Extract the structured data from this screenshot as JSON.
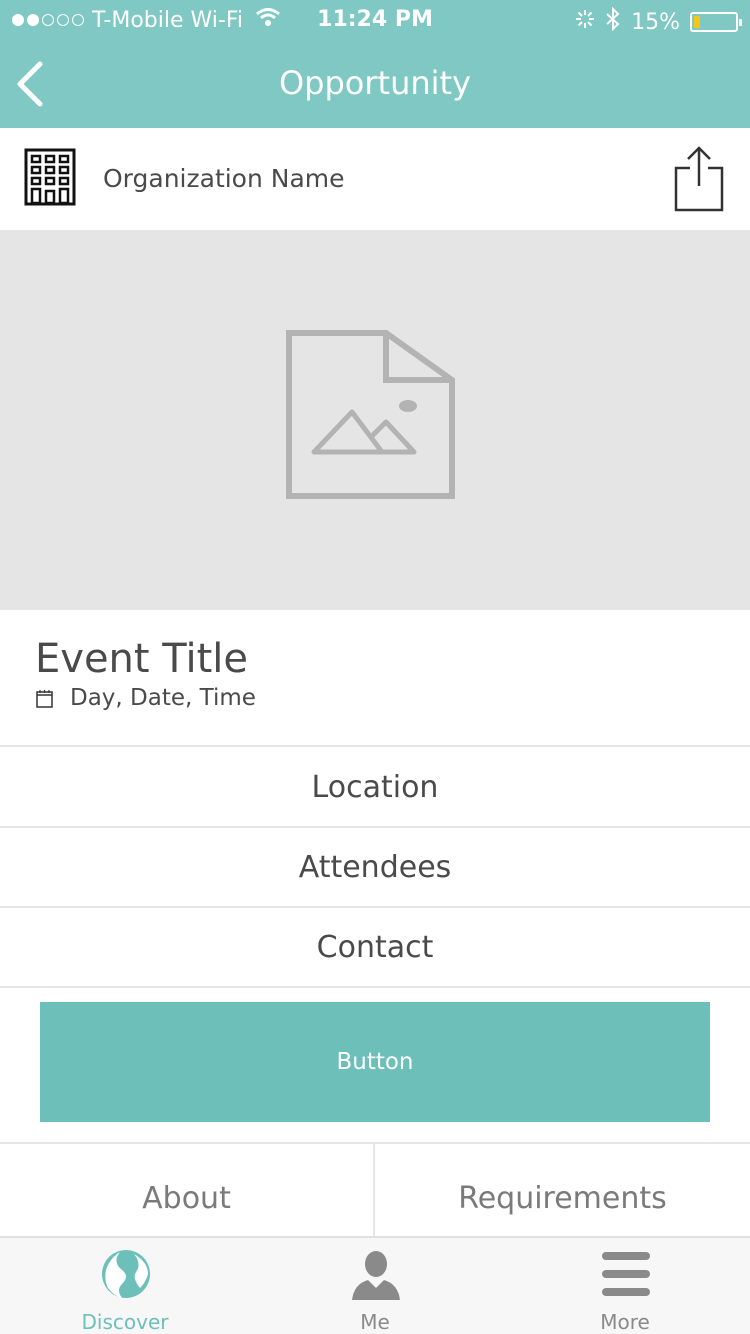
{
  "status_bar": {
    "carrier": "T-Mobile Wi-Fi",
    "time": "11:24 PM",
    "battery_percent": "15%",
    "battery_level": 0.15,
    "signal_bars": 2
  },
  "nav": {
    "title": "Opportunity"
  },
  "org": {
    "name": "Organization Name"
  },
  "event": {
    "title": "Event Title",
    "datetime": "Day, Date, Time"
  },
  "rows": [
    "Location",
    "Attendees",
    "Contact"
  ],
  "cta": {
    "label": "Button"
  },
  "sections": {
    "about": "About",
    "requirements": "Requirements"
  },
  "tabbar": {
    "discover": "Discover",
    "me": "Me",
    "more": "More"
  },
  "colors": {
    "teal": "#7fc8c3",
    "teal_button": "#6dbfba",
    "battery_yellow": "#f5c518"
  }
}
